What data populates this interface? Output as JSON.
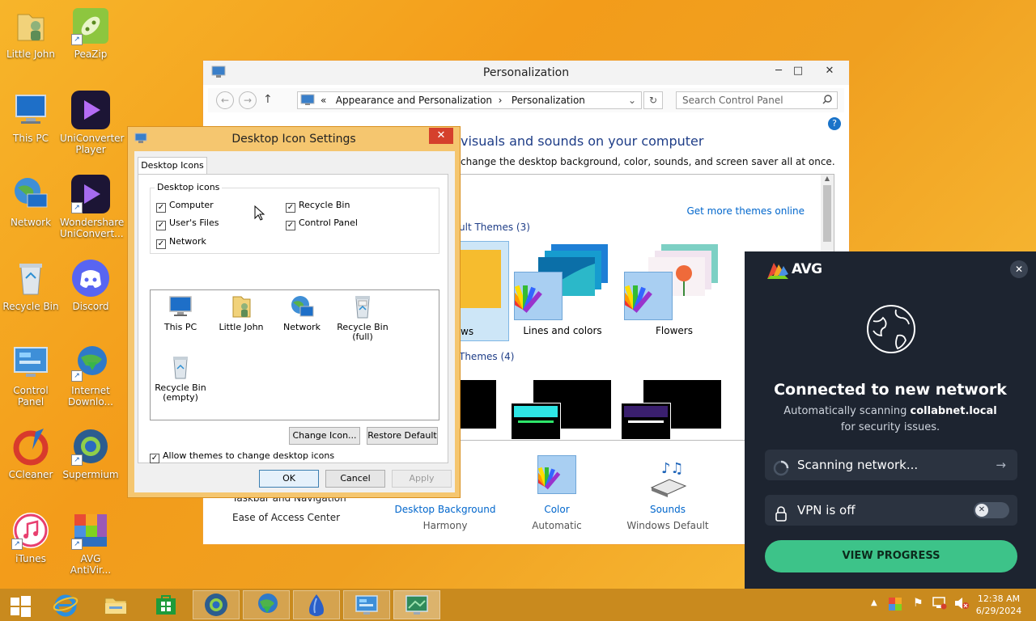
{
  "desktop": {
    "icons": [
      {
        "label": "Little John"
      },
      {
        "label": "PeaZip"
      },
      {
        "label": "This PC"
      },
      {
        "label": "UniConverter Player"
      },
      {
        "label": "Network"
      },
      {
        "label": "Wondershare UniConvert..."
      },
      {
        "label": "Recycle Bin"
      },
      {
        "label": "Discord"
      },
      {
        "label": "Control Panel"
      },
      {
        "label": "Internet Downlo..."
      },
      {
        "label": "CCleaner"
      },
      {
        "label": "Supermium"
      },
      {
        "label": "iTunes"
      },
      {
        "label": "AVG AntiVir..."
      }
    ]
  },
  "personalization": {
    "title": "Personalization",
    "breadcrumb_prefix": "«",
    "breadcrumb": [
      "Appearance and Personalization",
      "Personalization"
    ],
    "search_placeholder": "Search Control Panel",
    "heading": "visuals and sounds on your computer",
    "subheading": "change the desktop background, color, sounds, and screen saver all at once.",
    "get_more_themes": "Get more themes online",
    "default_themes_label": "ult Themes (3)",
    "themes": [
      {
        "label": "ws"
      },
      {
        "label": "Lines and colors"
      },
      {
        "label": "Flowers"
      }
    ],
    "high_contrast_label": "Themes (4)",
    "side_links": [
      "Taskbar and Navigation",
      "Ease of Access Center"
    ],
    "bottom_items": [
      {
        "label": "Desktop Background",
        "value": "Harmony"
      },
      {
        "label": "Color",
        "value": "Automatic"
      },
      {
        "label": "Sounds",
        "value": "Windows Default"
      }
    ]
  },
  "dialog": {
    "title": "Desktop Icon Settings",
    "tab": "Desktop Icons",
    "group_label": "Desktop icons",
    "checkboxes": [
      {
        "label": "Computer",
        "checked": true
      },
      {
        "label": "Recycle Bin",
        "checked": true
      },
      {
        "label": "User's Files",
        "checked": true
      },
      {
        "label": "Control Panel",
        "checked": true
      },
      {
        "label": "Network",
        "checked": true
      }
    ],
    "icons": [
      {
        "label": "This PC"
      },
      {
        "label": "Little John"
      },
      {
        "label": "Network"
      },
      {
        "label": "Recycle Bin (full)"
      },
      {
        "label": "Recycle Bin (empty)"
      }
    ],
    "change_icon": "Change Icon...",
    "restore_default": "Restore Default",
    "allow_themes": "Allow themes to change desktop icons",
    "ok": "OK",
    "cancel": "Cancel",
    "apply": "Apply"
  },
  "avg": {
    "brand": "AVG",
    "heading": "Connected to new network",
    "text_before": "Automatically scanning ",
    "network": "collabnet.local",
    "text_after": " for security issues.",
    "scanning": "Scanning network...",
    "vpn": "VPN is off",
    "button": "VIEW PROGRESS",
    "accent": "#3dc389"
  },
  "taskbar": {
    "time": "12:38 AM",
    "date": "6/29/2024"
  }
}
